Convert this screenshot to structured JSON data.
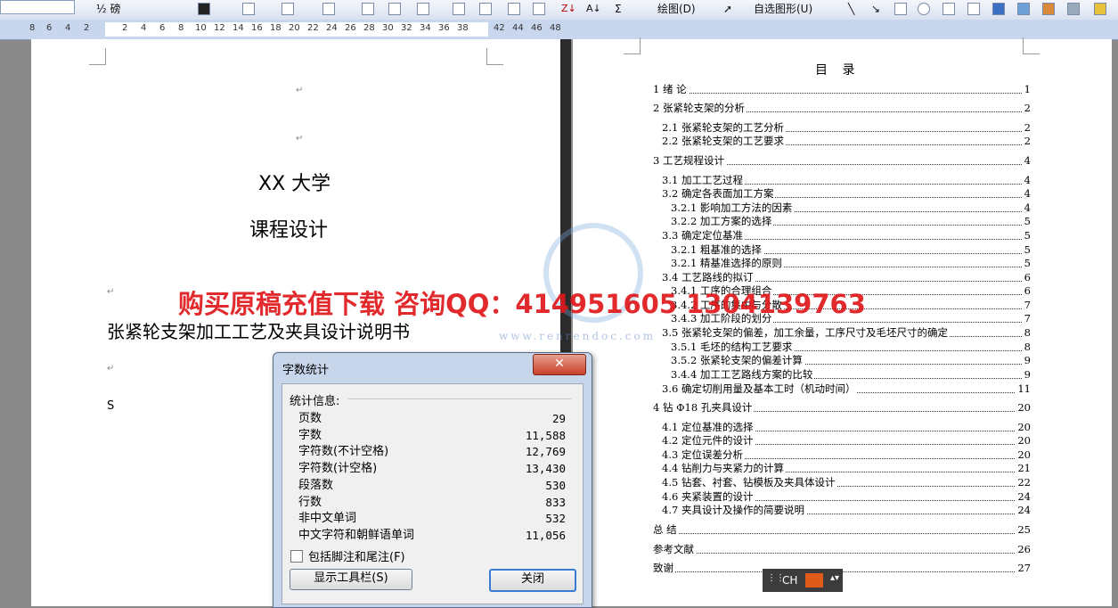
{
  "toolbar": {
    "font_size": "½ 磅",
    "draw_label": "绘图(D)",
    "autoshape_label": "自选图形(U)"
  },
  "ruler": {
    "ticks": [
      "8",
      "6",
      "4",
      "2",
      "2",
      "4",
      "6",
      "8",
      "10",
      "12",
      "14",
      "16",
      "18",
      "20",
      "22",
      "24",
      "26",
      "28",
      "30",
      "32",
      "34",
      "36",
      "38",
      "42",
      "44",
      "46",
      "48"
    ]
  },
  "left_page": {
    "university": "XX 大学",
    "course": "课程设计",
    "doc_title": "张紧轮支架加工工艺及夹具设计说明书",
    "s_char": "S",
    "para_mark": "↵"
  },
  "toc": {
    "title": "目  录",
    "items": [
      {
        "label": "1    绪  论",
        "page": "1"
      },
      {
        "label": "2     张紧轮支架的分析",
        "page": "2"
      },
      {
        "label": "2.1 张紧轮支架的工艺分析",
        "page": "2"
      },
      {
        "label": "2.2 张紧轮支架的工艺要求",
        "page": "2"
      },
      {
        "label": "3    工艺规程设计",
        "page": "4"
      },
      {
        "label": "3.1  加工工艺过程",
        "page": "4"
      },
      {
        "label": "3.2 确定各表面加工方案",
        "page": "4"
      },
      {
        "label": "3.2.1 影响加工方法的因素",
        "page": "4"
      },
      {
        "label": "3.2.2 加工方案的选择",
        "page": "5"
      },
      {
        "label": "3.3  确定定位基准",
        "page": "5"
      },
      {
        "label": "3.2.1 粗基准的选择",
        "page": "5"
      },
      {
        "label": "3.2.1 精基准选择的原则",
        "page": "5"
      },
      {
        "label": "3.4 工艺路线的拟订",
        "page": "6"
      },
      {
        "label": "3.4.1 工序的合理组合",
        "page": "6"
      },
      {
        "label": "3.4.2 工序的集中与分散",
        "page": "7"
      },
      {
        "label": "3.4.3 加工阶段的划分",
        "page": "7"
      },
      {
        "label": "3.5 张紧轮支架的偏差，加工余量，工序尺寸及毛坯尺寸的确定",
        "page": "8"
      },
      {
        "label": "3.5.1 毛坯的结构工艺要求",
        "page": "8"
      },
      {
        "label": "3.5.2 张紧轮支架的偏差计算",
        "page": "9"
      },
      {
        "label": "3.4.4 加工工艺路线方案的比较",
        "page": "9"
      },
      {
        "label": "3.6 确定切削用量及基本工时（机动时间）",
        "page": "11"
      },
      {
        "label": "4    钻 Φ18 孔夹具设计",
        "page": "20"
      },
      {
        "label": "4.1 定位基准的选择",
        "page": "20"
      },
      {
        "label": "4.2 定位元件的设计",
        "page": "20"
      },
      {
        "label": "4.3 定位误差分析",
        "page": "20"
      },
      {
        "label": "4.4 钻削力与夹紧力的计算",
        "page": "21"
      },
      {
        "label": "4.5 钻套、衬套、钻模板及夹具体设计",
        "page": "22"
      },
      {
        "label": "4.6 夹紧装置的设计",
        "page": "24"
      },
      {
        "label": "4.7 夹具设计及操作的简要说明",
        "page": "24"
      },
      {
        "label": "总  结",
        "page": "25"
      },
      {
        "label": "参考文献",
        "page": "26"
      },
      {
        "label": "致谢",
        "page": "27"
      }
    ]
  },
  "watermark": {
    "text": "购买原稿充值下载  咨询QQ：414951605  1304139763",
    "url": "www.renrendoc.com"
  },
  "dialog": {
    "title": "字数统计",
    "close_glyph": "✕",
    "header": "统计信息:",
    "stats": [
      {
        "label": "页数",
        "value": "29"
      },
      {
        "label": "字数",
        "value": "11,588"
      },
      {
        "label": "字符数(不计空格)",
        "value": "12,769"
      },
      {
        "label": "字符数(计空格)",
        "value": "13,430"
      },
      {
        "label": "段落数",
        "value": "530"
      },
      {
        "label": "行数",
        "value": "833"
      },
      {
        "label": "非中文单词",
        "value": "532"
      },
      {
        "label": "中文字符和朝鲜语单词",
        "value": "11,056"
      }
    ],
    "checkbox_label": "包括脚注和尾注(F)",
    "toolbar_button": "显示工具栏(S)",
    "close_button": "关闭"
  },
  "ime": {
    "lang": "CH"
  }
}
